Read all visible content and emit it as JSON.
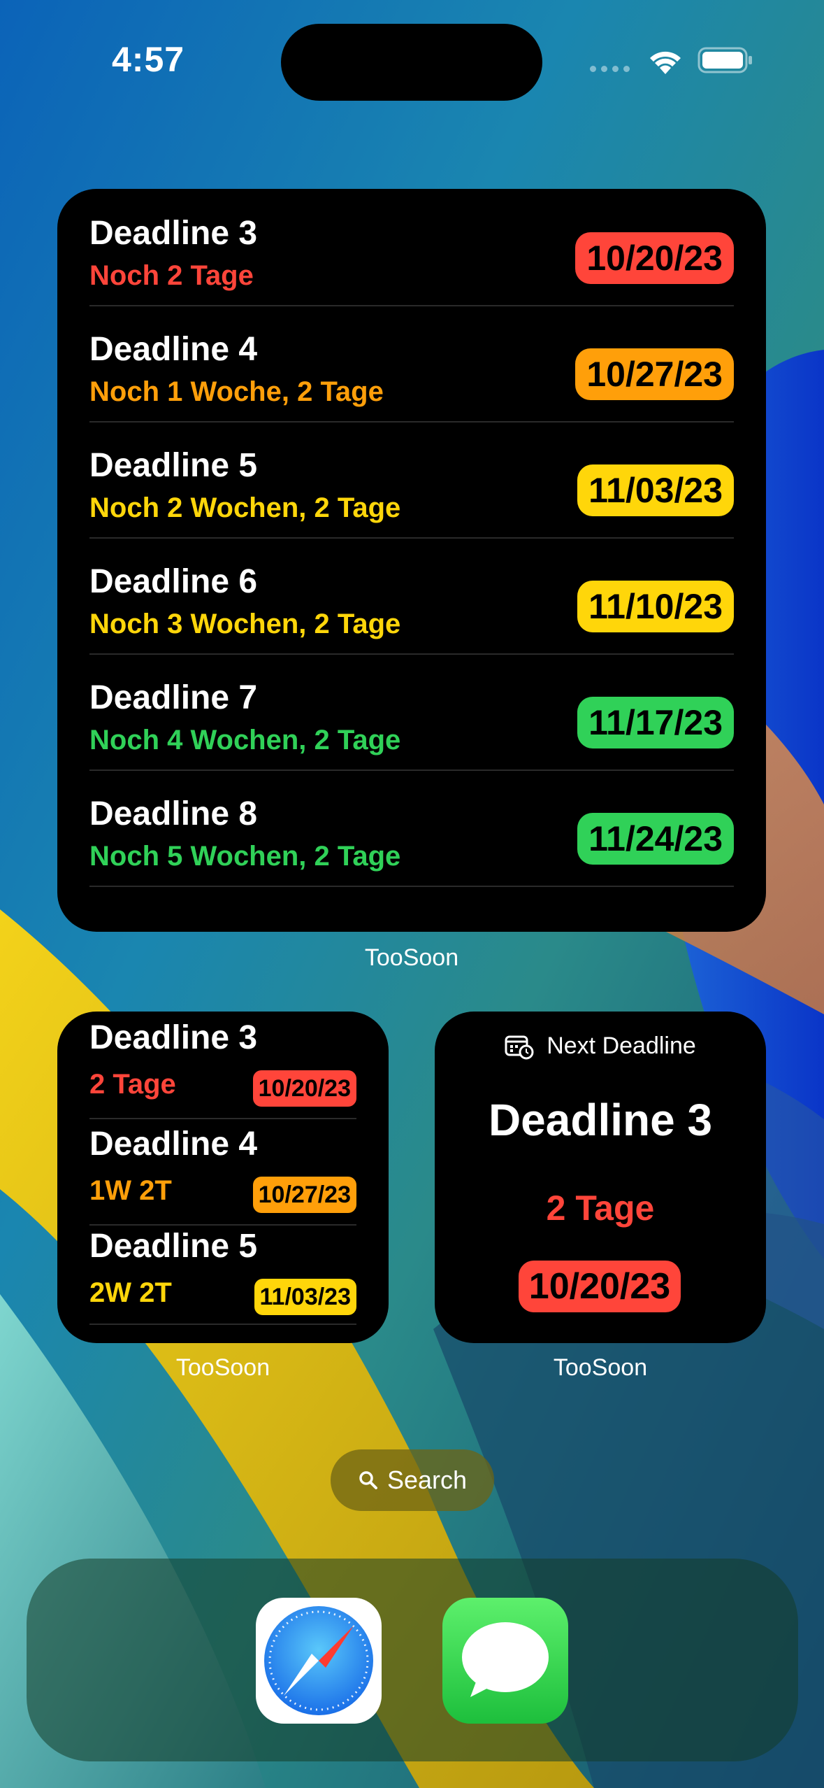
{
  "status_bar": {
    "time": "4:57"
  },
  "colors": {
    "red": "#ff453a",
    "orange": "#ff9f0a",
    "yellow": "#ffd60a",
    "green": "#30d158"
  },
  "large_widget": {
    "rows": [
      {
        "title": "Deadline 3",
        "subtitle": "Noch 2 Tage",
        "date": "10/20/23",
        "status": "red"
      },
      {
        "title": "Deadline 4",
        "subtitle": "Noch 1 Woche, 2 Tage",
        "date": "10/27/23",
        "status": "orange"
      },
      {
        "title": "Deadline 5",
        "subtitle": "Noch 2 Wochen, 2 Tage",
        "date": "11/03/23",
        "status": "yellow"
      },
      {
        "title": "Deadline 6",
        "subtitle": "Noch 3 Wochen, 2 Tage",
        "date": "11/10/23",
        "status": "yellow"
      },
      {
        "title": "Deadline 7",
        "subtitle": "Noch 4 Wochen, 2 Tage",
        "date": "11/17/23",
        "status": "green"
      },
      {
        "title": "Deadline 8",
        "subtitle": "Noch 5 Wochen, 2 Tage",
        "date": "11/24/23",
        "status": "green"
      }
    ],
    "label": "TooSoon"
  },
  "small_widget": {
    "rows": [
      {
        "title": "Deadline 3",
        "subtitle": "2 Tage",
        "date": "10/20/23",
        "status": "red"
      },
      {
        "title": "Deadline 4",
        "subtitle": "1W 2T",
        "date": "10/27/23",
        "status": "orange"
      },
      {
        "title": "Deadline 5",
        "subtitle": "2W 2T",
        "date": "11/03/23",
        "status": "yellow"
      }
    ],
    "label": "TooSoon"
  },
  "next_widget": {
    "header": "Next Deadline",
    "header_icon": "calendar-clock-icon",
    "title": "Deadline 3",
    "days": "2 Tage",
    "date": "10/20/23",
    "status": "red",
    "label": "TooSoon"
  },
  "search": {
    "label": "Search",
    "icon": "search-icon"
  },
  "dock": {
    "apps": [
      {
        "name": "Safari",
        "icon": "safari-icon"
      },
      {
        "name": "Messages",
        "icon": "messages-icon"
      }
    ]
  }
}
